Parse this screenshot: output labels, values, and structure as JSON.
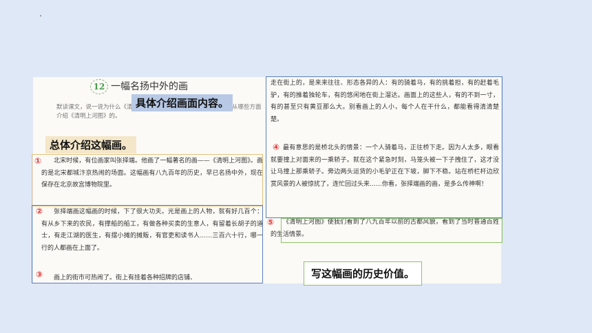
{
  "lesson": {
    "number": "12",
    "title": "一幅名扬中外的画"
  },
  "guide_text": "默读课文，说一说为什么《清明上河图》会名扬中外。找一找课文是从哪些方面介绍《清明上河图》的。",
  "labels": {
    "detail": "具体介绍画面内容。",
    "overall": "总体介绍这幅画。",
    "value": "写这幅画的历史价值。"
  },
  "markers": {
    "m1": "①",
    "m2": "②",
    "m3": "③",
    "m4": "④",
    "m5": "⑤"
  },
  "paragraphs": {
    "p1": "北宋时候，有位画家叫张择端。他画了一幅著名的画——《清明上河图》。画的是北宋都城汴京热闹的场面。这幅画有八九百年的历史，早已名扬中外，现在保存在北京故宫博物院里。",
    "p2": "张择端画这幅画的时候，下了很大功夫。光是画上的人物，就有好几百个：有从乡下来的农民，有撑船的船工，有做各种买卖的生意人，有留着长胡子的道士，有走江湖的医生，有摆小摊的摊贩，有官吏和读书人……三百六十行，哪一行的人都画在上面了。",
    "p3": "画上的街市可热闹了。街上有挂着各种招牌的店铺、",
    "p_top": "走在街上的，是来来往往、形态各异的人：有的骑着马，有的挑着担，有的赶着毛驴，有的推着独轮车，有的悠闲地在街上溜达。画面上的这些人，有的不到一寸，有的甚至只有黄豆那么大。别看画上的人小，每个人在干什么，都能看得清清楚楚。",
    "p4": "最有意思的是桥北头的情景：一个人骑着马，正往桥下走。因为人太多，眼看就要撞上对面来的一乘轿子。就在这个紧急时刻，马笼头被一下子拽住了，这才没让马撞上那乘轿子。旁边两头运货的小毛驴正在下坡，脚下不稳。站在桥栏杆边欣赏风景的人被惊扰了，连忙回过头来……你看，张择端画的画，是多么传神啊！",
    "p5": "《清明上河图》使我们看到了八九百年以前的古都风貌，看到了当时普通百姓的生活情景。"
  },
  "colors": {
    "blue_box": "#5b7fc4",
    "tan_box": "#e8c07a",
    "green_box": "#8fc16a",
    "marker": "#e03030"
  }
}
